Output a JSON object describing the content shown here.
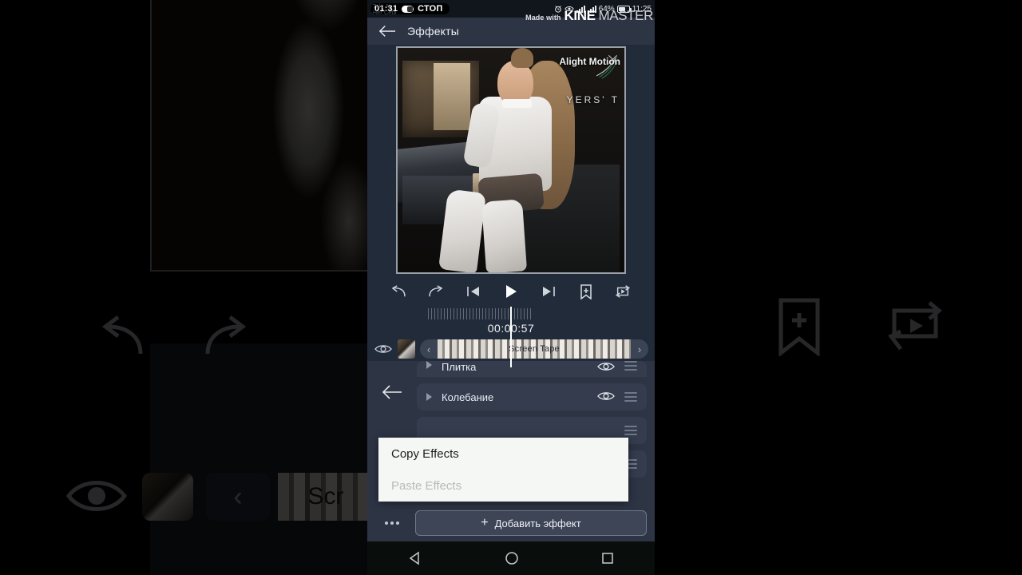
{
  "statusbar": {
    "recording_time": "01:31",
    "stop_label": "СТОП",
    "ghost_text_1": "Tele A",
    "ghost_text_2": "Her Ceta",
    "battery_percent": "64%",
    "clock": "11:25",
    "icons": [
      "alarm-icon",
      "eye-icon",
      "signal-icon",
      "battery-icon"
    ]
  },
  "watermark": {
    "made_with": "Made with",
    "brand_bold": "KINE",
    "brand_light": "MASTER"
  },
  "appbar": {
    "back_icon": "back-arrow-icon",
    "title": "Эффекты"
  },
  "preview": {
    "alight_motion_label": "Alight Motion",
    "overlay_text": "YERS'  T"
  },
  "transport": {
    "buttons": [
      {
        "name": "undo-button",
        "icon": "undo-icon"
      },
      {
        "name": "redo-button",
        "icon": "redo-icon"
      },
      {
        "name": "skip-start-button",
        "icon": "skip-to-start-icon"
      },
      {
        "name": "play-button",
        "icon": "play-icon"
      },
      {
        "name": "skip-end-button",
        "icon": "skip-to-end-icon"
      },
      {
        "name": "add-bookmark-button",
        "icon": "bookmark-plus-icon"
      },
      {
        "name": "loop-preview-button",
        "icon": "loop-play-icon"
      }
    ]
  },
  "timeline": {
    "current_time": "00:00:57",
    "track_visibility_icon": "eye-icon",
    "clip_label": "Screen Tape",
    "prev_arrow": "‹",
    "next_arrow": "›"
  },
  "effects": {
    "side_back_icon": "back-arrow-icon",
    "rows": [
      {
        "name": "Плитка",
        "visible": true
      },
      {
        "name": "Колебание",
        "visible": true
      }
    ]
  },
  "popup": {
    "copy_label": "Copy Effects",
    "paste_label": "Paste Effects"
  },
  "bottombar": {
    "more_icon": "more-options-icon",
    "add_effect_label": "Добавить эффект",
    "plus": "+"
  },
  "navbar": {
    "back": "nav-back-icon",
    "home": "nav-home-icon",
    "recents": "nav-recents-icon"
  },
  "colors": {
    "app_bg": "#222b3a",
    "panel": "#2d3444",
    "row": "#343c4e",
    "accent_text": "#eef1f5",
    "popup_bg": "#f5f7f4"
  }
}
